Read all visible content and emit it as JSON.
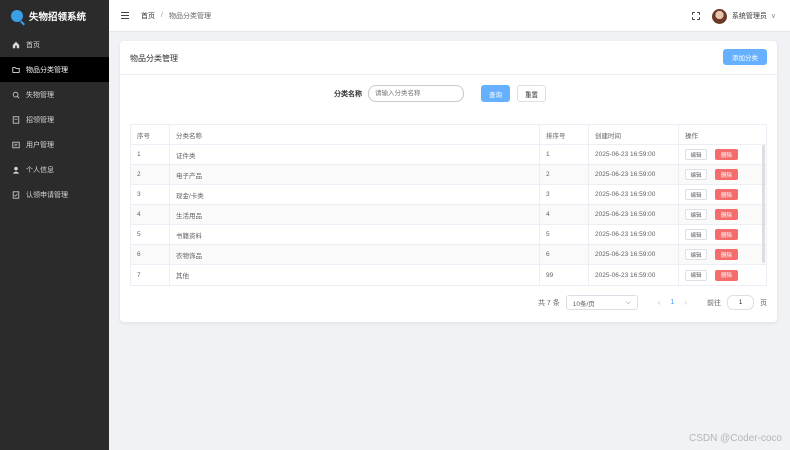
{
  "app": {
    "title": "失物招领系统"
  },
  "sidebar": {
    "items": [
      {
        "label": "首页",
        "icon": "home-icon"
      },
      {
        "label": "物品分类管理",
        "icon": "folder-icon",
        "active": true
      },
      {
        "label": "失物管理",
        "icon": "search-icon"
      },
      {
        "label": "招领管理",
        "icon": "document-icon"
      },
      {
        "label": "用户管理",
        "icon": "users-icon"
      },
      {
        "label": "个人信息",
        "icon": "user-icon"
      },
      {
        "label": "认领申请管理",
        "icon": "form-icon"
      }
    ]
  },
  "header": {
    "breadcrumb": [
      "首页",
      "/",
      "物品分类管理"
    ],
    "username": "系统管理员",
    "user_caret": "∨"
  },
  "card": {
    "title": "物品分类管理",
    "add_button": "添加分类"
  },
  "search": {
    "label": "分类名称",
    "placeholder": "请输入分类名称",
    "query_button": "查询",
    "reset_button": "重置"
  },
  "table": {
    "columns": [
      "序号",
      "分类名称",
      "排序号",
      "创建时间",
      "操作"
    ],
    "rows": [
      [
        "1",
        "证件类",
        "1",
        "2025-06-23 16:59:00"
      ],
      [
        "2",
        "电子产品",
        "2",
        "2025-06-23 16:59:00"
      ],
      [
        "3",
        "现金/卡类",
        "3",
        "2025-06-23 16:59:00"
      ],
      [
        "4",
        "生活用品",
        "4",
        "2025-06-23 16:59:00"
      ],
      [
        "5",
        "书籍资料",
        "5",
        "2025-06-23 16:59:00"
      ],
      [
        "6",
        "衣物饰品",
        "6",
        "2025-06-23 16:59:00"
      ],
      [
        "7",
        "其他",
        "99",
        "2025-06-23 16:59:00"
      ]
    ],
    "edit_label": "编辑",
    "delete_label": "删除"
  },
  "pagination": {
    "total": "共 7 条",
    "page_size": "10条/页",
    "prev": "‹",
    "current_page": "1",
    "next": "›",
    "goto_label": "前往",
    "goto_value": "1",
    "page_suffix": "页"
  },
  "watermark": "CSDN @Coder-coco",
  "colors": {
    "primary": "#66b1ff",
    "danger": "#f56c6c",
    "sidebar_bg": "#2b2b2b",
    "active_bg": "#000000"
  }
}
